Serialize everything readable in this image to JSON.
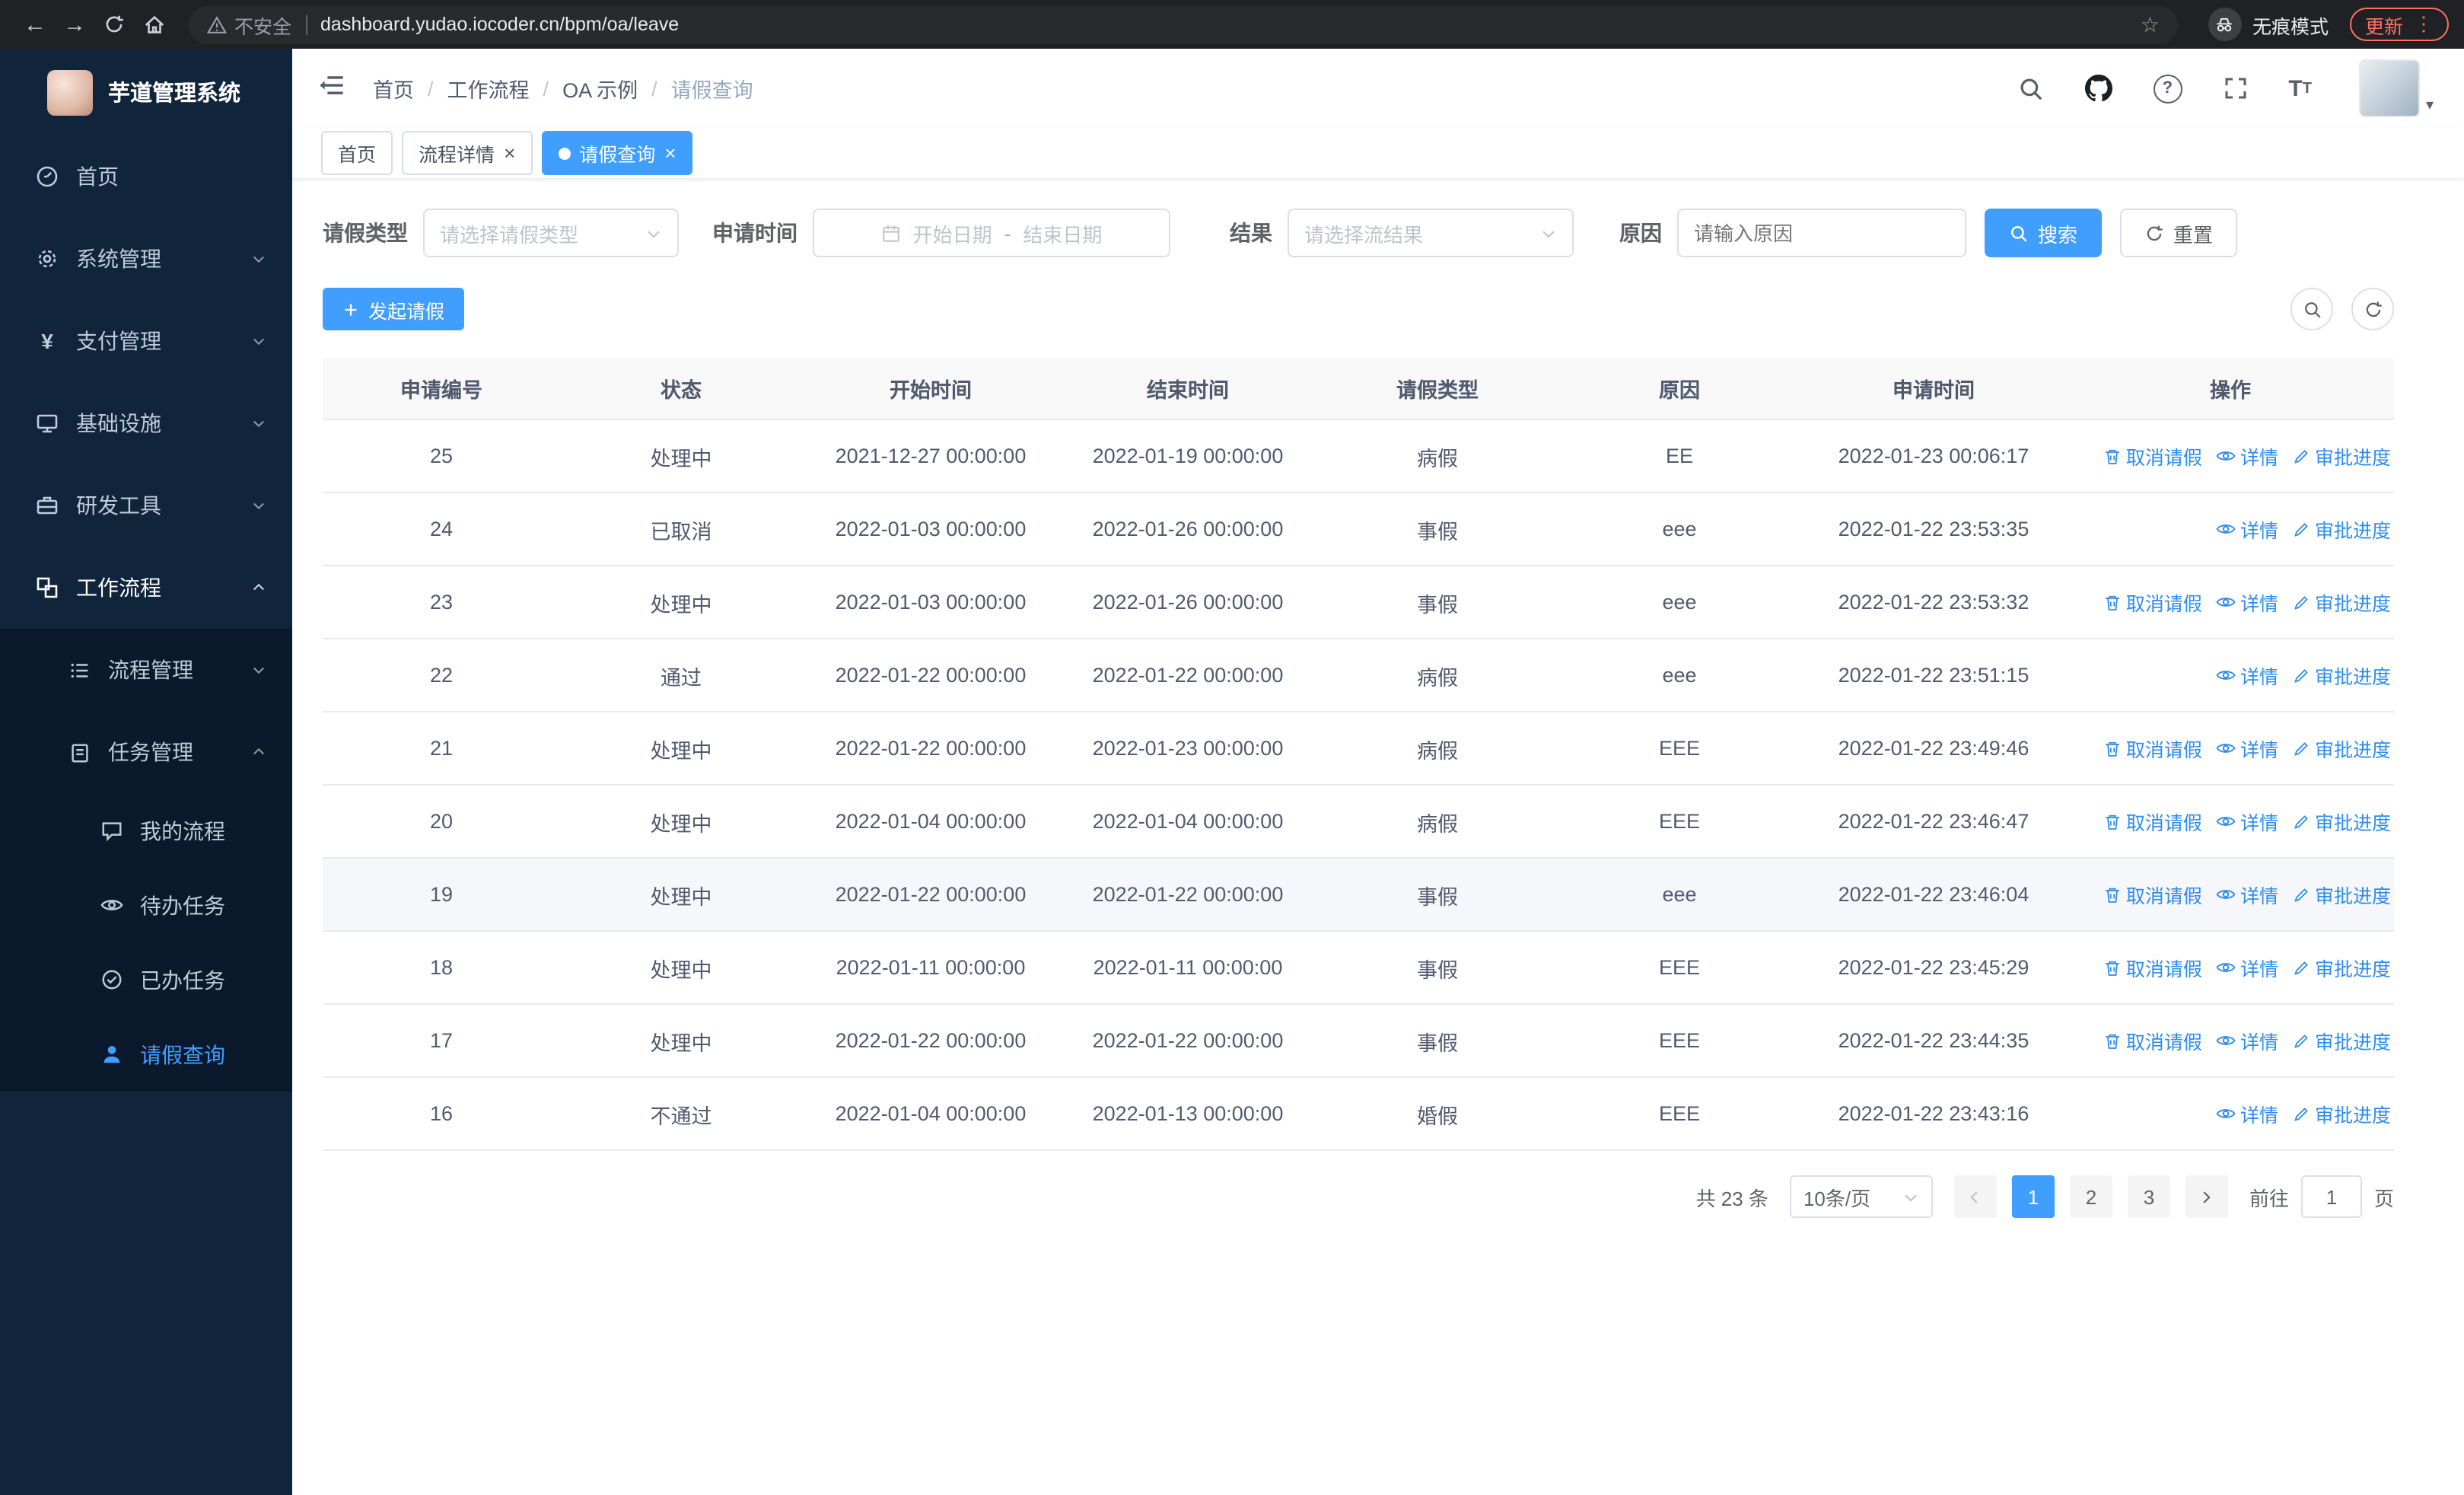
{
  "colors": {
    "primary": "#409eff",
    "sidebar_bg": "#10243c",
    "sidebar_submenu_bg": "#0a1a2c",
    "link": "#2d8cf0",
    "update_red": "#ff7066"
  },
  "browser": {
    "security_label": "不安全",
    "url": "dashboard.yudao.iocoder.cn/bpm/oa/leave",
    "incognito_label": "无痕模式",
    "update_label": "更新"
  },
  "sidebar": {
    "title": "芋道管理系统",
    "menu": [
      {
        "label": "首页",
        "icon": "dashboard-icon"
      },
      {
        "label": "系统管理",
        "icon": "gear-icon"
      },
      {
        "label": "支付管理",
        "icon": "yen-icon"
      },
      {
        "label": "基础设施",
        "icon": "monitor-icon"
      },
      {
        "label": "研发工具",
        "icon": "toolbox-icon"
      },
      {
        "label": "工作流程",
        "icon": "workflow-icon"
      }
    ],
    "workflow_children": [
      {
        "label": "流程管理",
        "icon": "list-icon"
      },
      {
        "label": "任务管理",
        "icon": "clipboard-icon"
      }
    ],
    "task_children": [
      {
        "label": "我的流程",
        "icon": "chat-icon"
      },
      {
        "label": "待办任务",
        "icon": "eye-icon"
      },
      {
        "label": "已办任务",
        "icon": "check-icon"
      },
      {
        "label": "请假查询",
        "icon": "user-icon"
      }
    ]
  },
  "header": {
    "breadcrumb": [
      "首页",
      "工作流程",
      "OA 示例",
      "请假查询"
    ]
  },
  "tabs": [
    {
      "label": "首页"
    },
    {
      "label": "流程详情"
    },
    {
      "label": "请假查询"
    }
  ],
  "filters": {
    "leave_type_label": "请假类型",
    "leave_type_placeholder": "请选择请假类型",
    "time_label": "申请时间",
    "start_placeholder": "开始日期",
    "range_separator": "-",
    "end_placeholder": "结束日期",
    "result_label": "结果",
    "result_placeholder": "请选择流结果",
    "reason_label": "原因",
    "reason_placeholder": "请输入原因",
    "search_label": "搜索",
    "reset_label": "重置"
  },
  "toolbar": {
    "create_label": "发起请假"
  },
  "table": {
    "columns": [
      "申请编号",
      "状态",
      "开始时间",
      "结束时间",
      "请假类型",
      "原因",
      "申请时间",
      "操作"
    ],
    "action_labels": {
      "cancel": "取消请假",
      "detail": "详情",
      "progress": "审批进度"
    },
    "rows": [
      {
        "id": "25",
        "status": "处理中",
        "start": "2021-12-27 00:00:00",
        "end": "2022-01-19 00:00:00",
        "type": "病假",
        "reason": "EE",
        "applied": "2022-01-23 00:06:17",
        "actions": [
          "cancel",
          "detail",
          "progress"
        ]
      },
      {
        "id": "24",
        "status": "已取消",
        "start": "2022-01-03 00:00:00",
        "end": "2022-01-26 00:00:00",
        "type": "事假",
        "reason": "eee",
        "applied": "2022-01-22 23:53:35",
        "actions": [
          "detail",
          "progress"
        ]
      },
      {
        "id": "23",
        "status": "处理中",
        "start": "2022-01-03 00:00:00",
        "end": "2022-01-26 00:00:00",
        "type": "事假",
        "reason": "eee",
        "applied": "2022-01-22 23:53:32",
        "actions": [
          "cancel",
          "detail",
          "progress"
        ]
      },
      {
        "id": "22",
        "status": "通过",
        "start": "2022-01-22 00:00:00",
        "end": "2022-01-22 00:00:00",
        "type": "病假",
        "reason": "eee",
        "applied": "2022-01-22 23:51:15",
        "actions": [
          "detail",
          "progress"
        ]
      },
      {
        "id": "21",
        "status": "处理中",
        "start": "2022-01-22 00:00:00",
        "end": "2022-01-23 00:00:00",
        "type": "病假",
        "reason": "EEE",
        "applied": "2022-01-22 23:49:46",
        "actions": [
          "cancel",
          "detail",
          "progress"
        ]
      },
      {
        "id": "20",
        "status": "处理中",
        "start": "2022-01-04 00:00:00",
        "end": "2022-01-04 00:00:00",
        "type": "病假",
        "reason": "EEE",
        "applied": "2022-01-22 23:46:47",
        "actions": [
          "cancel",
          "detail",
          "progress"
        ]
      },
      {
        "id": "19",
        "status": "处理中",
        "start": "2022-01-22 00:00:00",
        "end": "2022-01-22 00:00:00",
        "type": "事假",
        "reason": "eee",
        "applied": "2022-01-22 23:46:04",
        "actions": [
          "cancel",
          "detail",
          "progress"
        ],
        "highlighted": true
      },
      {
        "id": "18",
        "status": "处理中",
        "start": "2022-01-11 00:00:00",
        "end": "2022-01-11 00:00:00",
        "type": "事假",
        "reason": "EEE",
        "applied": "2022-01-22 23:45:29",
        "actions": [
          "cancel",
          "detail",
          "progress"
        ]
      },
      {
        "id": "17",
        "status": "处理中",
        "start": "2022-01-22 00:00:00",
        "end": "2022-01-22 00:00:00",
        "type": "事假",
        "reason": "EEE",
        "applied": "2022-01-22 23:44:35",
        "actions": [
          "cancel",
          "detail",
          "progress"
        ]
      },
      {
        "id": "16",
        "status": "不通过",
        "start": "2022-01-04 00:00:00",
        "end": "2022-01-13 00:00:00",
        "type": "婚假",
        "reason": "EEE",
        "applied": "2022-01-22 23:43:16",
        "actions": [
          "detail",
          "progress"
        ]
      }
    ]
  },
  "pagination": {
    "total": "共 23 条",
    "page_size": "10条/页",
    "pages": [
      "1",
      "2",
      "3"
    ],
    "active_page": "1",
    "goto_label": "前往",
    "goto_value": "1",
    "unit_label": "页"
  }
}
